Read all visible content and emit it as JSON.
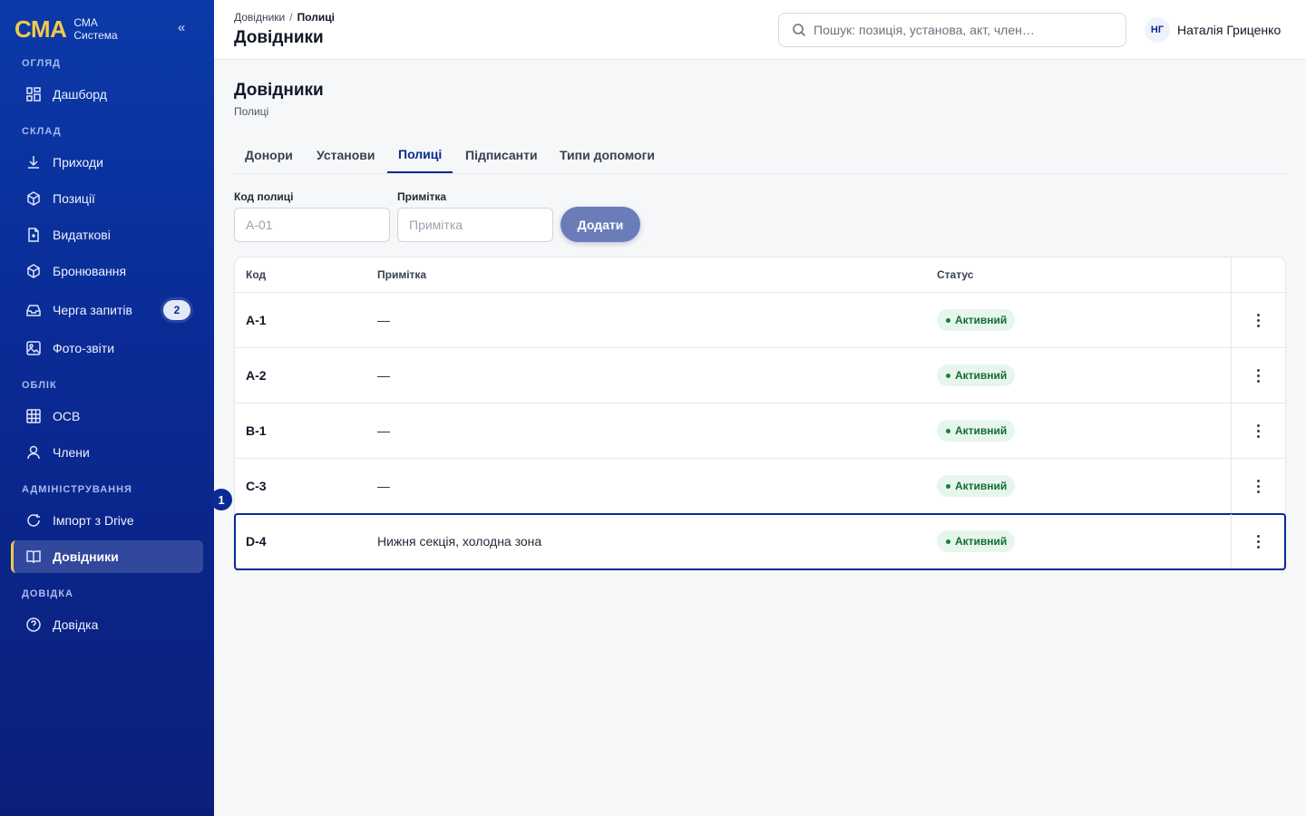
{
  "brand": {
    "logo": "СМА",
    "line1": "СМА",
    "line2": "Система",
    "collapse": "«"
  },
  "sidebar": {
    "sections": [
      {
        "label": "ОГЛЯД"
      },
      {
        "label": "СКЛАД"
      },
      {
        "label": "ОБЛІК"
      },
      {
        "label": "АДМІНІСТРУВАННЯ"
      },
      {
        "label": "ДОВІДКА"
      }
    ],
    "items": [
      {
        "label": "Дашборд",
        "icon": "dashboard-icon"
      },
      {
        "label": "Приходи",
        "icon": "download-icon"
      },
      {
        "label": "Позиції",
        "icon": "box-icon"
      },
      {
        "label": "Видаткові",
        "icon": "document-icon"
      },
      {
        "label": "Бронювання",
        "icon": "box-icon"
      },
      {
        "label": "Черга запитів",
        "icon": "inbox-icon",
        "badge": "2"
      },
      {
        "label": "Фото-звіти",
        "icon": "image-icon"
      },
      {
        "label": "ОСВ",
        "icon": "table-icon"
      },
      {
        "label": "Члени",
        "icon": "user-icon"
      },
      {
        "label": "Імпорт з Drive",
        "icon": "refresh-icon"
      },
      {
        "label": "Довідники",
        "icon": "book-icon",
        "active": true
      },
      {
        "label": "Довідка",
        "icon": "help-icon"
      }
    ]
  },
  "topbar": {
    "breadcrumb": {
      "parent": "Довідники",
      "separator": "/",
      "current": "Полиці"
    },
    "title": "Довідники",
    "search_placeholder": "Пошук: позиція, установа, акт, член…",
    "user": {
      "initials": "НГ",
      "name": "Наталія Гриценко"
    }
  },
  "main": {
    "title": "Довідники",
    "subtitle": "Полиці",
    "tabs": [
      {
        "label": "Донори"
      },
      {
        "label": "Установи"
      },
      {
        "label": "Полиці",
        "active": true
      },
      {
        "label": "Підписанти"
      },
      {
        "label": "Типи допомоги"
      }
    ],
    "form": {
      "code_label": "Код полиці",
      "code_placeholder": "A-01",
      "note_label": "Примітка",
      "note_placeholder": "Примітка",
      "add_label": "Додати"
    },
    "table": {
      "headers": {
        "code": "Код",
        "note": "Примітка",
        "status": "Статус"
      },
      "rows": [
        {
          "code": "A-1",
          "note": "—",
          "status": "Активний"
        },
        {
          "code": "A-2",
          "note": "—",
          "status": "Активний"
        },
        {
          "code": "B-1",
          "note": "—",
          "status": "Активний"
        },
        {
          "code": "C-3",
          "note": "—",
          "status": "Активний"
        },
        {
          "code": "D-4",
          "note": "Нижня секція, холодна зона",
          "status": "Активний",
          "selected": true
        }
      ]
    },
    "marker": "1"
  },
  "colors": {
    "sidebar": "#0b2a94",
    "accent": "#f2c94c",
    "primary": "#0b2a94",
    "button": "#6a7db9",
    "status_bg": "#e6f6ec",
    "status_text": "#146c35"
  }
}
